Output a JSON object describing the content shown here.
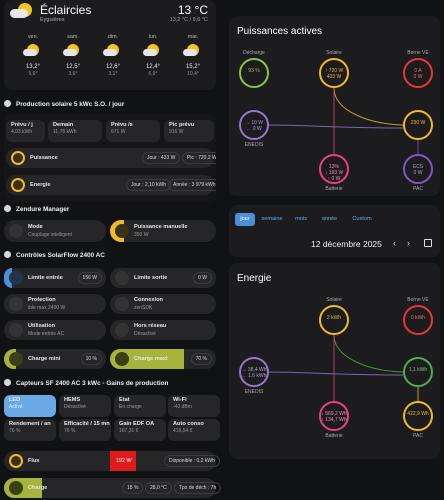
{
  "weather": {
    "condition": "Éclaircies",
    "location": "Eyguières",
    "temperature": "13 °C",
    "range": "13,2 °C / 9,6 °C",
    "days": [
      {
        "d": "ven.",
        "hi": "13,2°",
        "lo": "9,6°"
      },
      {
        "d": "sam.",
        "hi": "12,5°",
        "lo": "3,6°"
      },
      {
        "d": "dim.",
        "hi": "12,6°",
        "lo": "3,1°"
      },
      {
        "d": "lun.",
        "hi": "12,4°",
        "lo": "6,9°"
      },
      {
        "d": "mar.",
        "hi": "15,2°",
        "lo": "10,4°"
      }
    ]
  },
  "prod": {
    "title": "Production solaire 5 kWc S.O. / jour",
    "tiles": [
      {
        "l": "Prévu / j",
        "v": "4,03 kWh"
      },
      {
        "l": "Demain",
        "v": "11,76 kWh"
      },
      {
        "l": "Prévu /s",
        "v": "671 W"
      },
      {
        "l": "Pic prévu",
        "v": "916 W"
      }
    ],
    "puissance": {
      "l": "Puissance",
      "a": "Jour : 433 W",
      "b": "Pic : 720,2 W"
    },
    "energie": {
      "l": "Energie",
      "a": "Jour : 2,10 kWh",
      "b": "Année : 3 979 kWh"
    }
  },
  "zendure": {
    "title": "Zendure Manager",
    "mode_l": "Mode",
    "mode_v": "Couplage intelligent",
    "pm_l": "Puissance manuelle",
    "pm_v": "350 W"
  },
  "controls": {
    "title": "Contrôles SolarFlow 2400 AC",
    "limite_entree": {
      "l": "Limite entrée",
      "v": "156 W"
    },
    "limite_sortie": {
      "l": "Limite sortie",
      "v": "0 W"
    },
    "protection": {
      "l": "Protection",
      "v": "ible max 2400 W"
    },
    "connexion": {
      "l": "Connexion",
      "v": "zenSDK"
    },
    "utilisation": {
      "l": "Utilisation",
      "v": "Mode entrée AC"
    },
    "hors_reseau": {
      "l": "Hors réseau",
      "v": "Désactivé"
    },
    "charge_mini": {
      "l": "Charge mini",
      "v": "10 %"
    },
    "charge_maxi": {
      "l": "Charge maxi",
      "v": "70 %"
    }
  },
  "sensors": {
    "title": "Capteurs SF 2400 AC 3 kWc - Gains de production",
    "tiles": [
      {
        "l": "LED",
        "v": "Activé"
      },
      {
        "l": "HEMS",
        "v": "Désactivé"
      },
      {
        "l": "Etat",
        "v": "En charge"
      },
      {
        "l": "Wi-Fi",
        "v": "-43 dBm"
      },
      {
        "l": "Rendement / an",
        "v": "76 %"
      },
      {
        "l": "Efficacité / 15 mn",
        "v": "76 %"
      },
      {
        "l": "Gain EDF OA",
        "v": "167,31 €"
      },
      {
        "l": "Auto conso",
        "v": "419,54 €"
      }
    ],
    "flux": {
      "l": "Flux",
      "bar": "192 W",
      "dispo": "Disponible : 0,2 kWh"
    },
    "charge": {
      "l": "Charge",
      "pct": "18 %",
      "temp": "28,0 °C",
      "tps": "Tps de déch : 7h"
    }
  },
  "power": {
    "title": "Puissances actives",
    "decharge": "Décharge",
    "decharge_pct": "93 %",
    "solaire": "Solaire",
    "solaire_a": "↑ 720 W",
    "solaire_b": "433 W",
    "borne": "Borne VE",
    "borne_a": "0 A",
    "borne_b": "0 W",
    "enedis": "ENEDIS",
    "enedis_a": "→ 10 W",
    "enedis_b": "← 0 W",
    "home": "230 W",
    "batterie": "Batterie",
    "batt_pct": "13%",
    "batt_a": "↓ 193 W",
    "batt_b": "↑ 0 W",
    "pac": "PAC",
    "pac_a": "ECS",
    "pac_b": "0 W"
  },
  "date": {
    "tabs": [
      "jour",
      "semaine",
      "mois",
      "année",
      "Custom"
    ],
    "date": "12 décembre 2025"
  },
  "energy": {
    "title": "Energie",
    "solaire": "Solaire",
    "solaire_v": "2 kWh",
    "borne": "Borne VE",
    "borne_v": "0 kWh",
    "enedis": "ENEDIS",
    "enedis_a": "→ 38,4 Wh",
    "enedis_b": "← 1,6 kWh",
    "home": "1,1 kWh",
    "batterie": "Batterie",
    "batt_a": "↓ 569,2 Wh",
    "batt_b": "↑ 134,7 Wh",
    "pac": "PAC",
    "pac_v": "422,9 Wh"
  }
}
